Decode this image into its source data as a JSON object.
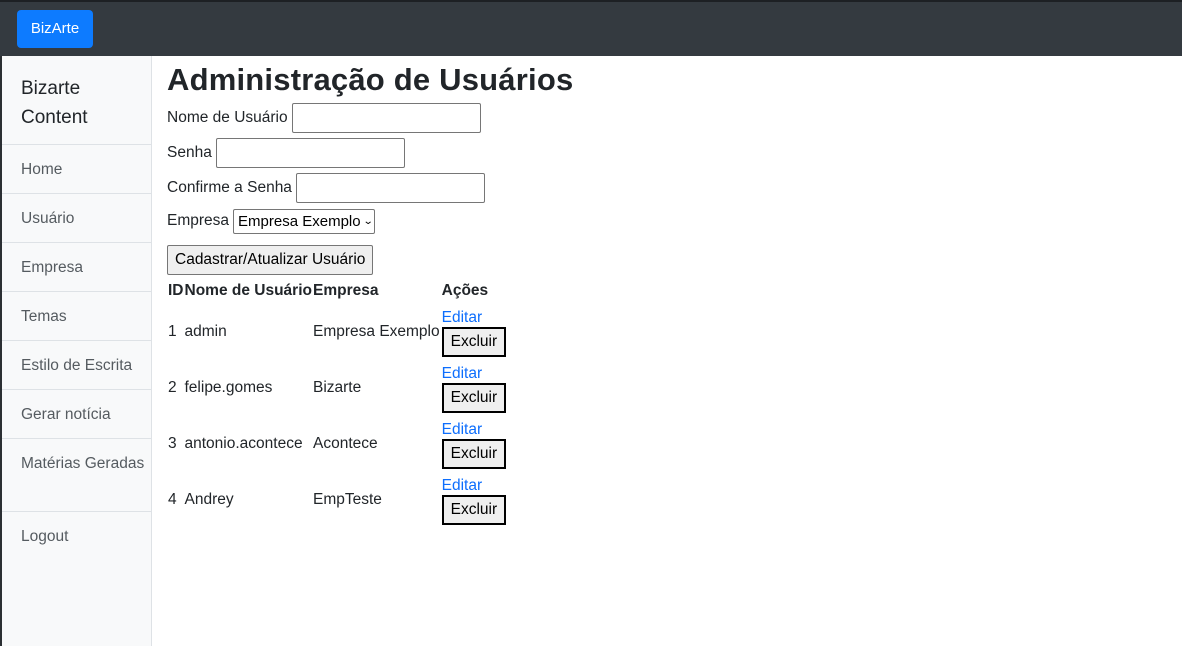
{
  "topbar": {
    "brand_label": "BizArte"
  },
  "sidebar": {
    "title": "Bizarte Content",
    "items": [
      {
        "label": "Home"
      },
      {
        "label": "Usuário"
      },
      {
        "label": "Empresa"
      },
      {
        "label": "Temas"
      },
      {
        "label": "Estilo de Escrita"
      },
      {
        "label": "Gerar notícia"
      },
      {
        "label": "Matérias Geradas"
      },
      {
        "label": "Logout"
      }
    ]
  },
  "main": {
    "title": "Administração de Usuários",
    "form": {
      "username_label": "Nome de Usuário",
      "username_value": "",
      "password_label": "Senha",
      "password_value": "",
      "confirm_label": "Confirme a Senha",
      "confirm_value": "",
      "company_label": "Empresa",
      "company_selected": "Empresa Exemplo",
      "submit_label": "Cadastrar/Atualizar Usuário"
    },
    "table": {
      "headers": [
        "ID",
        "Nome de Usuário",
        "Empresa",
        "Ações"
      ],
      "rows": [
        {
          "id": "1",
          "username": "admin",
          "company": "Empresa Exemplo",
          "edit": "Editar",
          "delete": "Excluir"
        },
        {
          "id": "2",
          "username": "felipe.gomes",
          "company": "Bizarte",
          "edit": "Editar",
          "delete": "Excluir"
        },
        {
          "id": "3",
          "username": "antonio.acontece",
          "company": "Acontece",
          "edit": "Editar",
          "delete": "Excluir"
        },
        {
          "id": "4",
          "username": "Andrey",
          "company": "EmpTeste",
          "edit": "Editar",
          "delete": "Excluir"
        }
      ]
    }
  },
  "colors": {
    "topbar_bg": "#343a40",
    "brand_button": "#0d7bff",
    "sidebar_bg": "#f8f9fa",
    "link": "#0d6efd"
  }
}
